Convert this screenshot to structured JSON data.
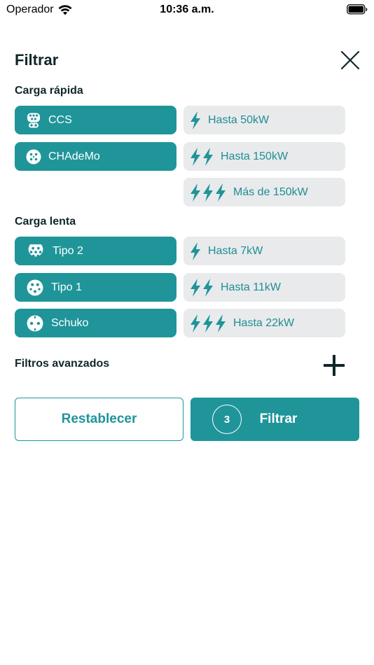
{
  "status": {
    "carrier": "Operador",
    "time": "10:36 a.m."
  },
  "header": {
    "title": "Filtrar"
  },
  "fast": {
    "title": "Carga rápida",
    "connectors": [
      {
        "label": "CCS",
        "icon": "ccs-connector-icon"
      },
      {
        "label": "CHAdeMo",
        "icon": "chademo-connector-icon"
      }
    ],
    "powers": [
      {
        "label": "Hasta 50kW",
        "bolts": 1
      },
      {
        "label": "Hasta 150kW",
        "bolts": 2
      },
      {
        "label": "Más de 150kW",
        "bolts": 3
      }
    ]
  },
  "slow": {
    "title": "Carga lenta",
    "connectors": [
      {
        "label": "Tipo 2",
        "icon": "type2-connector-icon"
      },
      {
        "label": "Tipo 1",
        "icon": "type1-connector-icon"
      },
      {
        "label": "Schuko",
        "icon": "schuko-connector-icon"
      }
    ],
    "powers": [
      {
        "label": "Hasta 7kW",
        "bolts": 1
      },
      {
        "label": "Hasta 11kW",
        "bolts": 2
      },
      {
        "label": "Hasta 22kW",
        "bolts": 3
      }
    ]
  },
  "advanced": {
    "label": "Filtros avanzados"
  },
  "actions": {
    "reset_label": "Restablecer",
    "filter_label": "Filtrar",
    "filter_count": "3"
  },
  "colors": {
    "accent": "#1f959a",
    "chip_inactive": "#e9eaec",
    "text_dark": "#10262a"
  }
}
